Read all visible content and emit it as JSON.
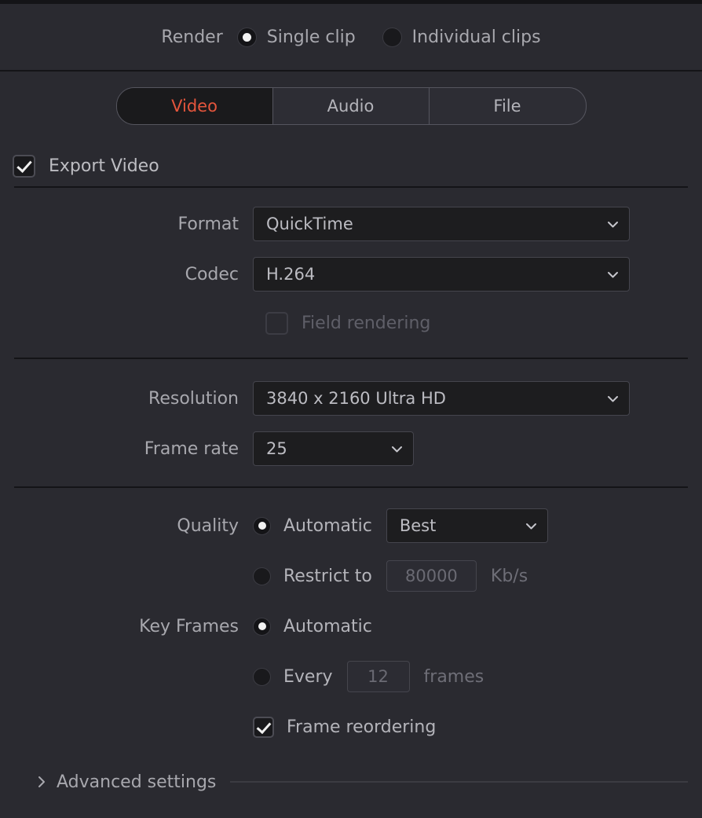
{
  "colors": {
    "panel_bg": "#2a2a30",
    "field_bg": "#1d1d1f",
    "accent": "#e4553c",
    "text": "#b4b4ba",
    "muted_text": "#6a6a73",
    "divider": "#141417"
  },
  "render_mode": {
    "label": "Render",
    "options": [
      {
        "label": "Single clip",
        "selected": true
      },
      {
        "label": "Individual clips",
        "selected": false
      }
    ]
  },
  "tabs": [
    {
      "label": "Video",
      "active": true
    },
    {
      "label": "Audio",
      "active": false
    },
    {
      "label": "File",
      "active": false
    }
  ],
  "export_video": {
    "label": "Export Video",
    "checked": true
  },
  "video_settings": {
    "format": {
      "label": "Format",
      "value": "QuickTime",
      "chevron": "chevron-down-icon"
    },
    "codec": {
      "label": "Codec",
      "value": "H.264",
      "chevron": "chevron-down-icon"
    },
    "field_rendering": {
      "label": "Field rendering",
      "checked": false,
      "disabled": true
    },
    "resolution": {
      "label": "Resolution",
      "value": "3840 x 2160 Ultra HD",
      "chevron": "chevron-down-icon"
    },
    "frame_rate": {
      "label": "Frame rate",
      "value": "25",
      "chevron": "chevron-down-icon"
    }
  },
  "quality": {
    "label": "Quality",
    "automatic": {
      "label": "Automatic",
      "selected": true,
      "preset": "Best",
      "chevron": "chevron-down-icon"
    },
    "restrict": {
      "label": "Restrict to",
      "selected": false,
      "value": "80000",
      "unit": "Kb/s"
    }
  },
  "key_frames": {
    "label": "Key Frames",
    "automatic": {
      "label": "Automatic",
      "selected": true
    },
    "every": {
      "label": "Every",
      "selected": false,
      "value": "12",
      "unit": "frames"
    }
  },
  "frame_reordering": {
    "label": "Frame reordering",
    "checked": true
  },
  "advanced_settings": {
    "label": "Advanced settings",
    "expanded": false,
    "chevron": "chevron-right-icon"
  }
}
